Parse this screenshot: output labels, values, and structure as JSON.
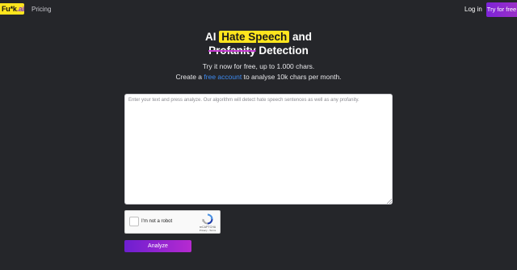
{
  "nav": {
    "logo_main": "Fu*k",
    "logo_dot": ".ai",
    "pricing": "Pricing",
    "login": "Log in",
    "try_free": "Try for free"
  },
  "hero": {
    "title_prefix": "AI",
    "title_highlight": "Hate Speech",
    "title_and": "and",
    "title_strike": "Profanity",
    "title_suffix": "Detection",
    "line1": "Try it now for free, up to 1.000 chars.",
    "line2_prefix": "Create a",
    "line2_link": "free account",
    "line2_suffix": "to analyse 10k chars per month."
  },
  "input": {
    "placeholder": "Enter your text and press analyze. Our algorithm will detect hate speech sentences as well as any profanity.",
    "value": ""
  },
  "captcha": {
    "label": "I'm not a robot",
    "brand": "reCAPTCHA",
    "terms": "Privacy - Terms"
  },
  "actions": {
    "analyze": "Analyze"
  },
  "colors": {
    "background": "#25262a",
    "highlight": "#ffe51e",
    "accent_purple": "#7d23d8",
    "link": "#3d8bf2"
  }
}
